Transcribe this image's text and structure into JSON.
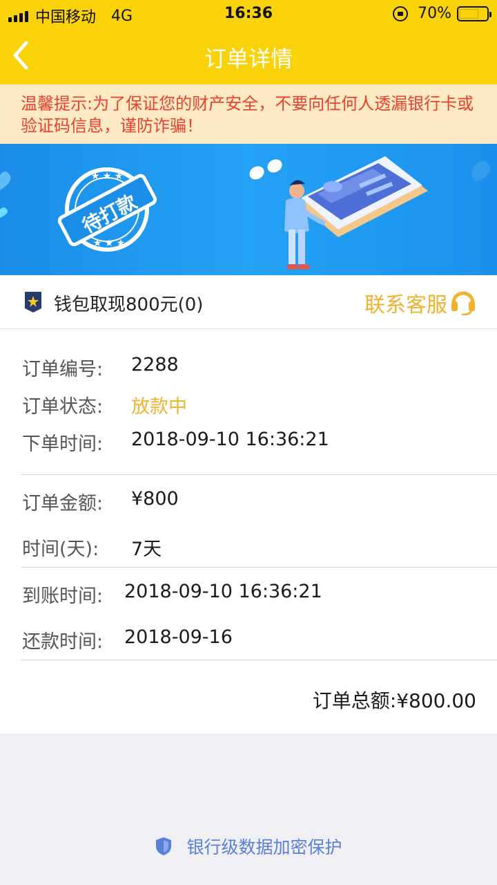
{
  "status_bar": {
    "carrier": "中国移动",
    "network": "4G",
    "time": "16:36",
    "battery": "70%"
  },
  "nav": {
    "title": "订单详情",
    "back_icon": "chevron-left-icon"
  },
  "notice": {
    "text": "温馨提示:为了保证您的财产安全，不要向任何人透漏银行卡或验证码信息，谨防诈骗！"
  },
  "banner": {
    "stamp_text": "待打款"
  },
  "order_header": {
    "title": "钱包取现800元(0)",
    "contact_label": "联系客服"
  },
  "details": {
    "order_no_label": "订单编号:",
    "order_no": "2288",
    "status_label": "订单状态:",
    "status": "放款中",
    "created_label": "下单时间:",
    "created": "2018-09-10 16:36:21",
    "amount_label": "订单金额:",
    "amount": "¥800",
    "days_label": "时间(天):",
    "days": "7天",
    "arrival_label": "到账时间:",
    "arrival": "2018-09-10 16:36:21",
    "repay_label": "还款时间:",
    "repay": "2018-09-16",
    "total_label": "订单总额:",
    "total": "¥800.00"
  },
  "footer": {
    "text": "银行级数据加密保护"
  },
  "colors": {
    "brand_yellow": "#f9d20a",
    "accent_orange": "#f1b22d",
    "warning_red": "#e8422f",
    "banner_blue": "#1a8de8",
    "footer_blue": "#5a7fd8"
  }
}
